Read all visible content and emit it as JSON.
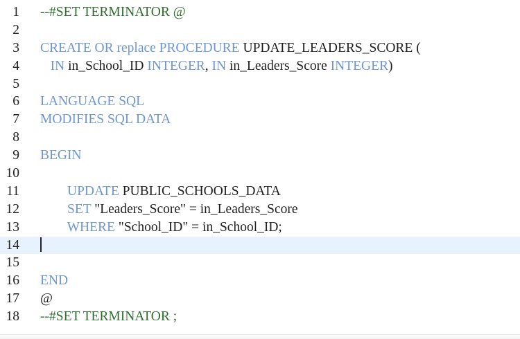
{
  "editor": {
    "lines": [
      {
        "number": "1",
        "indent": "",
        "tokens": [
          {
            "t": "--#SET TERMINATOR @",
            "c": "cm"
          }
        ]
      },
      {
        "number": "2",
        "indent": "",
        "tokens": []
      },
      {
        "number": "3",
        "indent": "",
        "tokens": [
          {
            "t": "CREATE OR replace PROCEDURE",
            "c": "kw"
          },
          {
            "t": " UPDATE_LEADERS_SCORE (",
            "c": ""
          }
        ]
      },
      {
        "number": "4",
        "indent": "   ",
        "tokens": [
          {
            "t": "IN",
            "c": "kw"
          },
          {
            "t": " in_School_ID ",
            "c": ""
          },
          {
            "t": "INTEGER",
            "c": "kw"
          },
          {
            "t": ", ",
            "c": ""
          },
          {
            "t": "IN",
            "c": "kw"
          },
          {
            "t": " in_Leaders_Score ",
            "c": ""
          },
          {
            "t": "INTEGER",
            "c": "kw"
          },
          {
            "t": ")",
            "c": ""
          }
        ]
      },
      {
        "number": "5",
        "indent": "",
        "tokens": []
      },
      {
        "number": "6",
        "indent": "",
        "tokens": [
          {
            "t": "LANGUAGE SQL",
            "c": "kw"
          }
        ]
      },
      {
        "number": "7",
        "indent": "",
        "tokens": [
          {
            "t": "MODIFIES SQL DATA",
            "c": "kw"
          }
        ]
      },
      {
        "number": "8",
        "indent": "",
        "tokens": []
      },
      {
        "number": "9",
        "indent": "",
        "tokens": [
          {
            "t": "BEGIN",
            "c": "kw"
          }
        ]
      },
      {
        "number": "10",
        "indent": "",
        "tokens": []
      },
      {
        "number": "11",
        "indent": "        ",
        "tokens": [
          {
            "t": "UPDATE",
            "c": "kw"
          },
          {
            "t": " PUBLIC_SCHOOLS_DATA",
            "c": ""
          }
        ]
      },
      {
        "number": "12",
        "indent": "        ",
        "tokens": [
          {
            "t": "SET",
            "c": "kw"
          },
          {
            "t": " \"Leaders_Score\" = in_Leaders_Score",
            "c": ""
          }
        ]
      },
      {
        "number": "13",
        "indent": "        ",
        "tokens": [
          {
            "t": "WHERE",
            "c": "kw"
          },
          {
            "t": " \"School_ID\" = in_School_ID;",
            "c": ""
          }
        ]
      },
      {
        "number": "14",
        "indent": "",
        "tokens": [],
        "active": true,
        "cursor": true
      },
      {
        "number": "15",
        "indent": "",
        "tokens": []
      },
      {
        "number": "16",
        "indent": "",
        "tokens": [
          {
            "t": "END",
            "c": "kw"
          }
        ]
      },
      {
        "number": "17",
        "indent": "",
        "tokens": [
          {
            "t": "@",
            "c": ""
          }
        ]
      },
      {
        "number": "18",
        "indent": "",
        "tokens": [
          {
            "t": "--#SET TERMINATOR ;",
            "c": "cm"
          }
        ]
      }
    ]
  },
  "colors": {
    "keyword": "#6e97d2",
    "comment": "#2f6f2f",
    "text": "#1f1f1f",
    "active_line": "#e8f2fe"
  }
}
